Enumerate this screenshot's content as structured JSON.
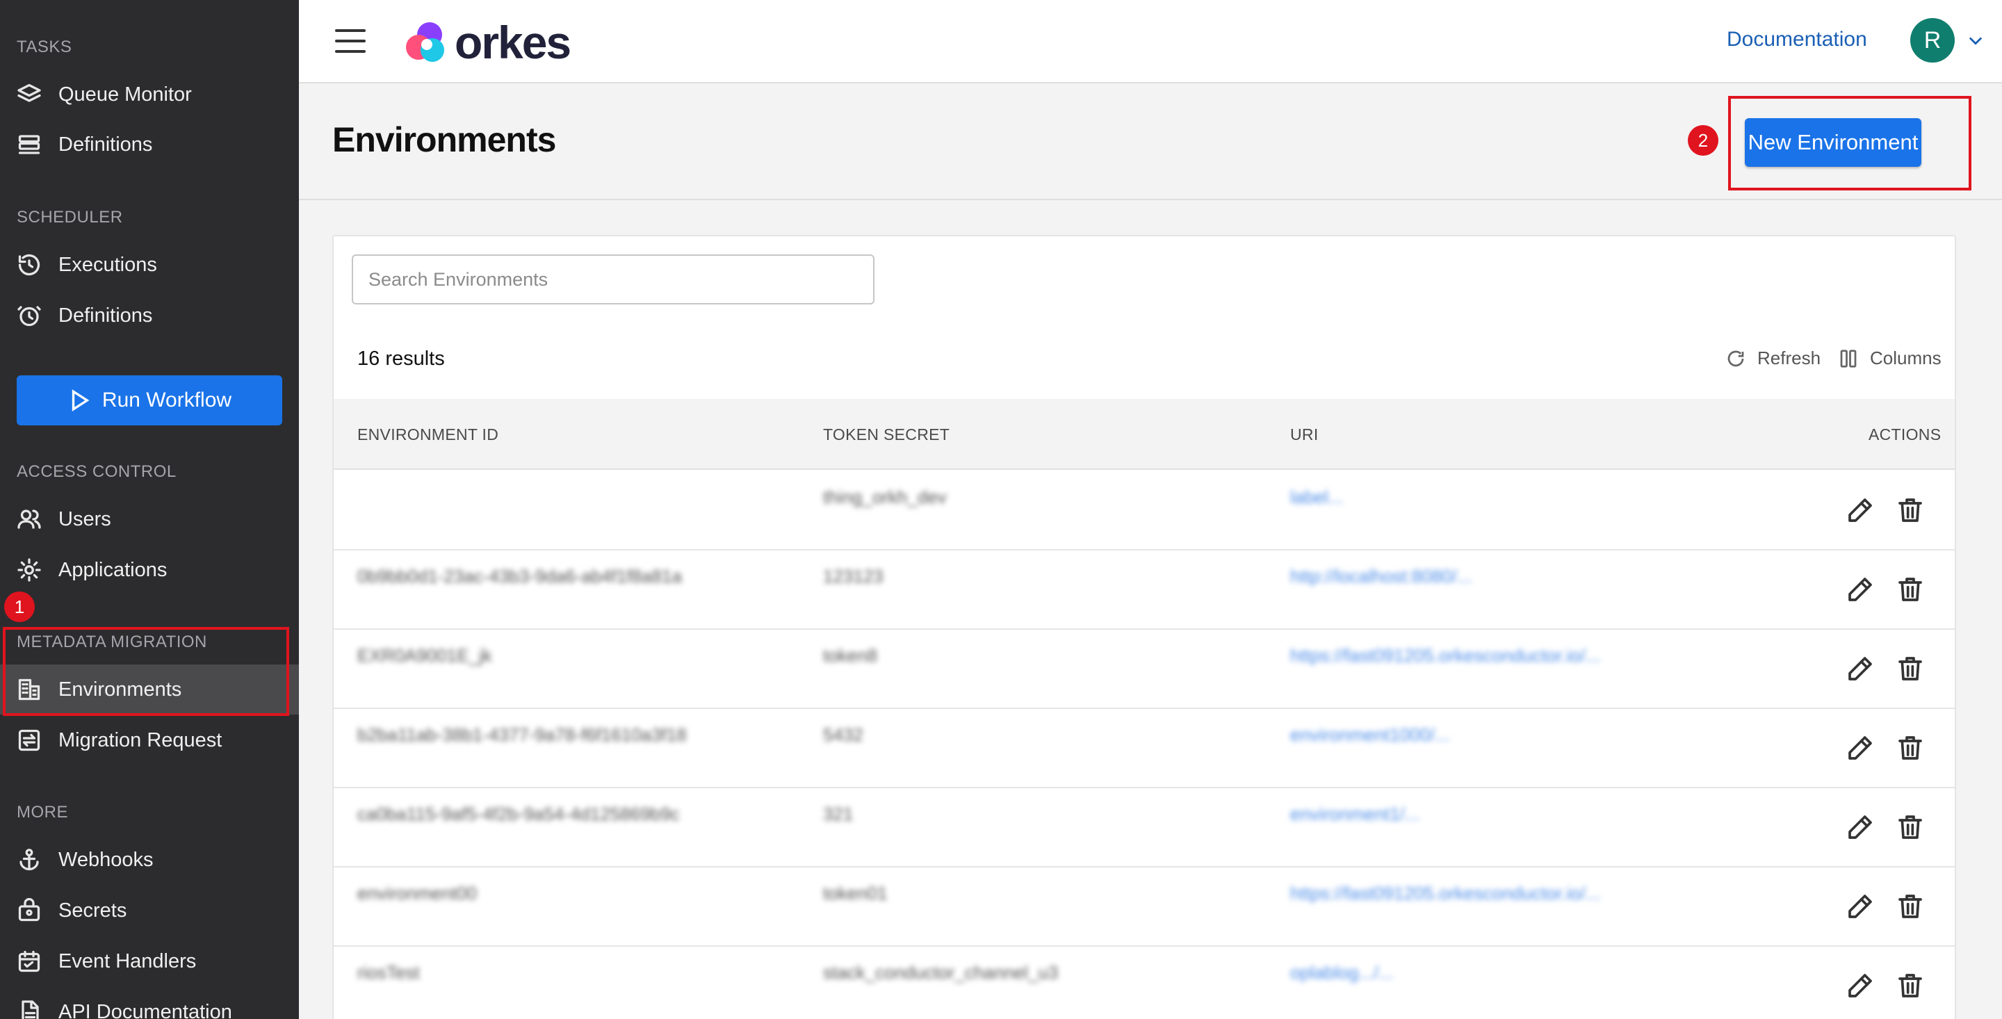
{
  "sidebar": {
    "sections": {
      "tasks": "TASKS",
      "scheduler": "SCHEDULER",
      "access_control": "ACCESS CONTROL",
      "metadata_migration": "METADATA MIGRATION",
      "more": "MORE"
    },
    "items": {
      "queue_monitor": "Queue Monitor",
      "task_definitions": "Definitions",
      "executions": "Executions",
      "scheduler_definitions": "Definitions",
      "users": "Users",
      "applications": "Applications",
      "environments": "Environments",
      "migration_request": "Migration Request",
      "webhooks": "Webhooks",
      "secrets": "Secrets",
      "event_handlers": "Event Handlers",
      "api_documentation": "API Documentation"
    },
    "run_workflow": "Run Workflow"
  },
  "header": {
    "logo_text": "orkes",
    "documentation": "Documentation",
    "avatar_initial": "R"
  },
  "page": {
    "title": "Environments",
    "new_button": "New Environment"
  },
  "annotations": {
    "step1": "1",
    "step2": "2"
  },
  "table": {
    "search_placeholder": "Search Environments",
    "results": "16 results",
    "refresh": "Refresh",
    "columns": "Columns",
    "headers": {
      "id": "ENVIRONMENT ID",
      "token": "TOKEN SECRET",
      "uri": "URI",
      "actions": "ACTIONS"
    },
    "rows": [
      {
        "id": "",
        "token": "thing_orkh_dev",
        "uri": "label..."
      },
      {
        "id": "0b9bb0d1-23ac-43b3-9da6-ab4f1f8a81a",
        "token": "123123",
        "uri": "http://localhost:8080/..."
      },
      {
        "id": "EXR0A9001E_jk",
        "token": "token8",
        "uri": "https://fast091205.orkesconductor.io/..."
      },
      {
        "id": "b2ba11ab-38b1-4377-9a78-f6f1610a3f18",
        "token": "5432",
        "uri": "environment1000/..."
      },
      {
        "id": "ca0ba115-9af5-4f2b-9a54-4d125869b9c",
        "token": "321",
        "uri": "environment1/..."
      },
      {
        "id": "environment00",
        "token": "token01",
        "uri": "https://fast091205.orkesconductor.io/..."
      },
      {
        "id": "riosTest",
        "token": "stack_conductor_channel_u3",
        "uri": "oplablog.../..."
      }
    ]
  },
  "colors": {
    "accent": "#1a73e8",
    "sidebar_bg": "#2c2c2e",
    "highlight": "#e0141e",
    "avatar": "#107e6e"
  }
}
